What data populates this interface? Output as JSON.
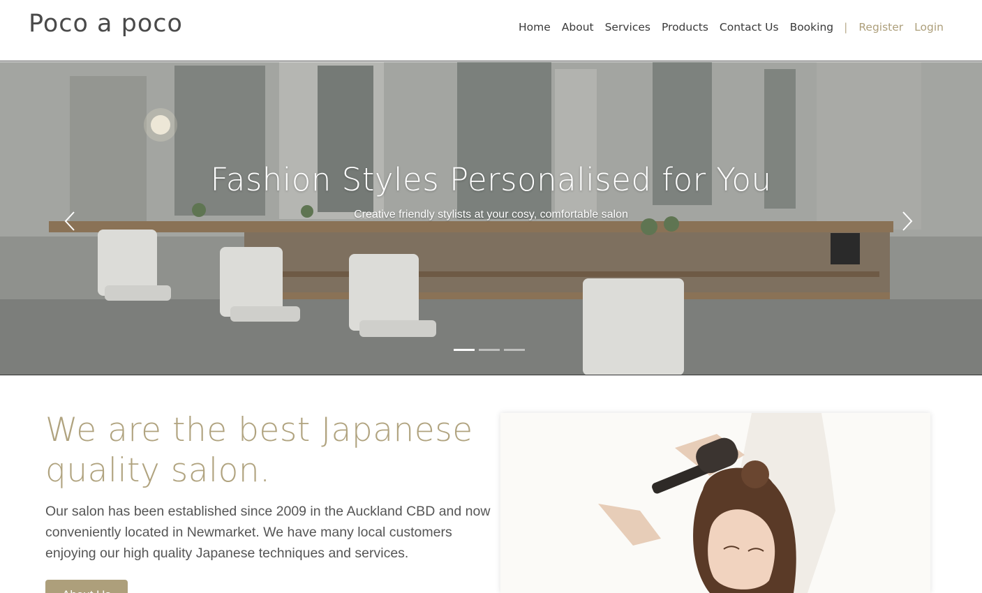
{
  "header": {
    "brand": "Poco a poco",
    "nav": {
      "home": "Home",
      "about": "About",
      "services": "Services",
      "products": "Products",
      "contact": "Contact Us",
      "booking": "Booking",
      "separator": "|",
      "register": "Register",
      "login": "Login"
    }
  },
  "hero": {
    "title": "Fashion Styles Personalised for You",
    "subtitle": "Creative friendly stylists at your cosy, comfortable salon",
    "slide_count": 3,
    "active_slide": 1,
    "prev_icon": "chevron-left-icon",
    "next_icon": "chevron-right-icon"
  },
  "about": {
    "heading": "We are the best Japanese quality salon.",
    "text": "Our salon has been established since 2009 in the Auckland CBD and now conveniently located in Newmarket. We have many local customers enjoying our high quality Japanese techniques and services.",
    "button_label": "About Us"
  },
  "colors": {
    "accent": "#ad9f7b",
    "heading_accent": "#b0a37f",
    "text": "#555555"
  }
}
